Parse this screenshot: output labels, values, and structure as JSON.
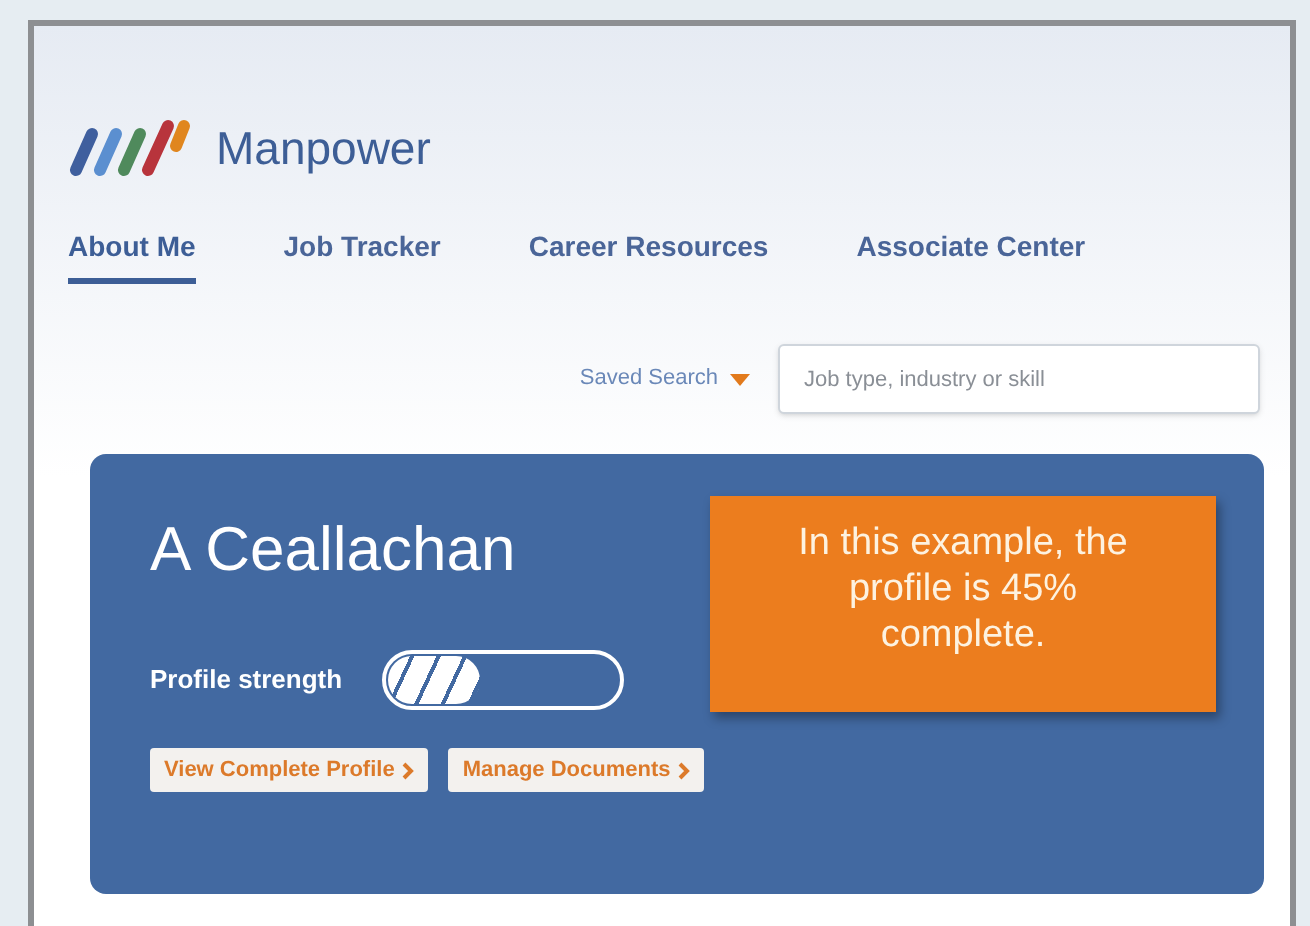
{
  "brand": {
    "name": "Manpower"
  },
  "tabs": [
    {
      "label": "About Me",
      "selected": true
    },
    {
      "label": "Job Tracker",
      "selected": false
    },
    {
      "label": "Career Resources",
      "selected": false
    },
    {
      "label": "Associate Center",
      "selected": false
    }
  ],
  "saved_search": {
    "label": "Saved Search"
  },
  "search": {
    "placeholder": "Job type, industry or skill"
  },
  "profile": {
    "name": "A Ceallachan",
    "strength_label": "Profile strength",
    "level": 0.4,
    "buttons": [
      "View Complete Profile",
      "Manage Documents"
    ]
  },
  "callout": {
    "text": "In this example, the profile is 45% complete."
  }
}
